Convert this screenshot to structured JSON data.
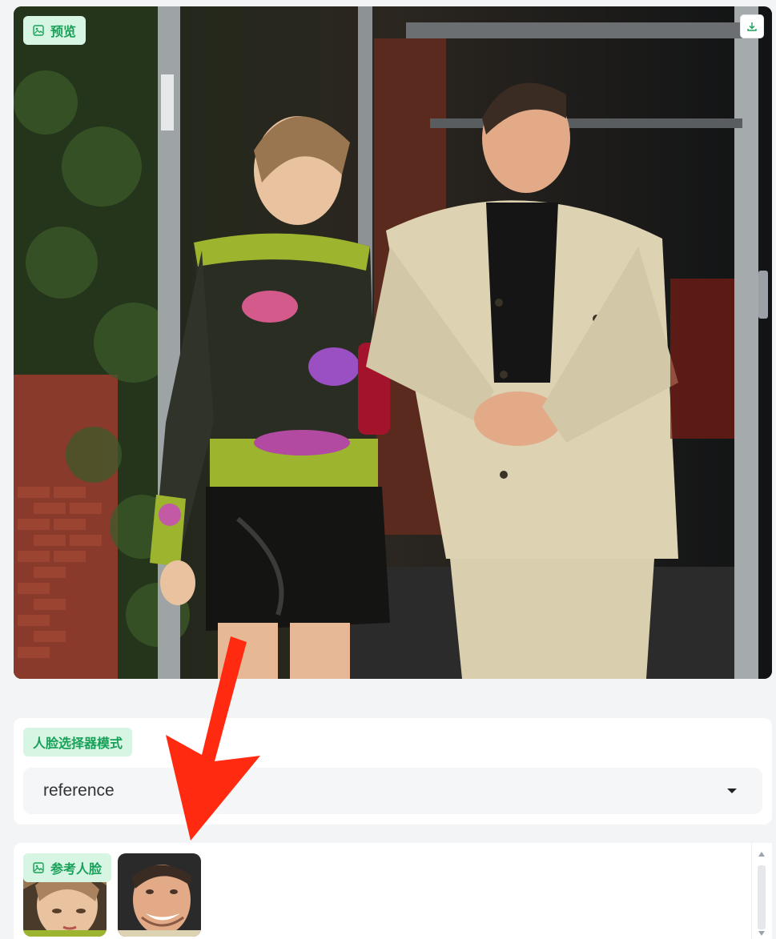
{
  "preview": {
    "label": "预览",
    "label_icon": "image-icon",
    "download_icon": "download-icon"
  },
  "face_selector": {
    "label": "人脸选择器模式",
    "selected_value": "reference"
  },
  "reference_faces": {
    "label": "参考人脸",
    "label_icon": "image-icon"
  },
  "colors": {
    "accent_green": "#18a058",
    "chip_bg": "#d6f5e3",
    "annotation_arrow": "#ff2a10"
  }
}
